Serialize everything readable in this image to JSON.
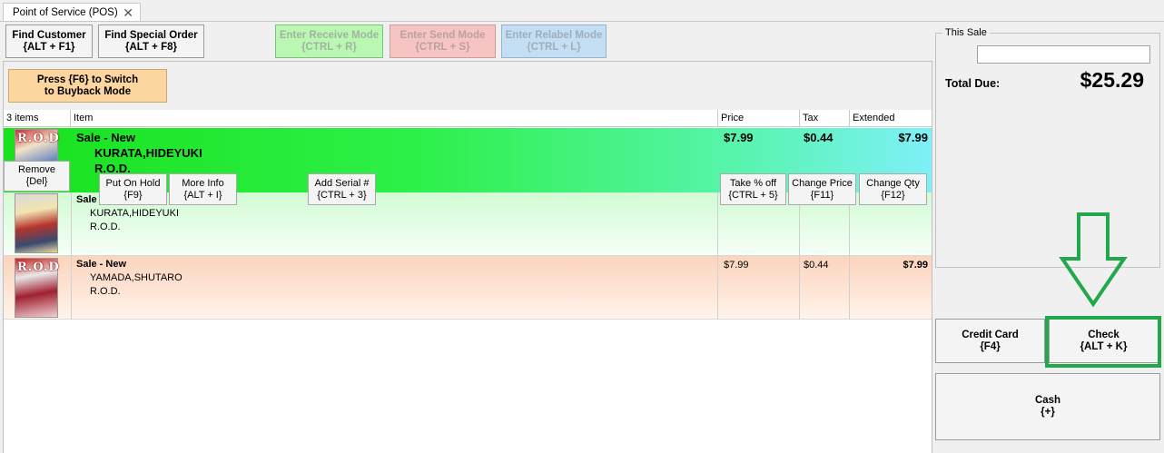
{
  "tab": {
    "title": "Point of Service (POS)",
    "close": "✕"
  },
  "toolbar": {
    "find_customer": {
      "label": "Find Customer",
      "shortcut": "{ALT + F1}"
    },
    "find_special_order": {
      "label": "Find Special Order",
      "shortcut": "{ALT + F8}"
    },
    "receive_mode": {
      "label": "Enter Receive Mode",
      "shortcut": "{CTRL + R}"
    },
    "send_mode": {
      "label": "Enter Send Mode",
      "shortcut": "{CTRL + S}"
    },
    "relabel_mode": {
      "label": "Enter Relabel Mode",
      "shortcut": "{CTRL + L}"
    }
  },
  "buyback": {
    "line1": "Press {F6} to Switch",
    "line2": "to Buyback Mode"
  },
  "grid": {
    "headers": {
      "count": "3 items",
      "item": "Item",
      "price": "Price",
      "tax": "Tax",
      "extended": "Extended"
    },
    "rows": [
      {
        "cover_title": "R.O.D",
        "type": "Sale - New",
        "author": "KURATA,HIDEYUKI",
        "title": "R.O.D.",
        "price": "$7.99",
        "tax": "$0.44",
        "extended": "$7.99"
      },
      {
        "cover_title": "",
        "type": "Sale",
        "author": "KURATA,HIDEYUKI",
        "title": "R.O.D.",
        "price": "",
        "tax": "",
        "extended": ""
      },
      {
        "cover_title": "R.O.D",
        "type": "Sale - New",
        "author": "YAMADA,SHUTARO",
        "title": "R.O.D.",
        "price": "$7.99",
        "tax": "$0.44",
        "extended": "$7.99"
      }
    ]
  },
  "row_actions": {
    "remove": {
      "label": "Remove",
      "shortcut": "{Del}"
    },
    "put_on_hold": {
      "label": "Put On Hold",
      "shortcut": "{F9}"
    },
    "more_info": {
      "label": "More Info",
      "shortcut": "{ALT + I}"
    },
    "add_serial": {
      "label": "Add Serial #",
      "shortcut": "{CTRL + 3}"
    },
    "take_percent_off": {
      "label": "Take % off",
      "shortcut": "{CTRL + 5}"
    },
    "change_price": {
      "label": "Change Price",
      "shortcut": "{F11}"
    },
    "change_qty": {
      "label": "Change Qty",
      "shortcut": "{F12}"
    }
  },
  "sale": {
    "legend": "This Sale",
    "input_value": "",
    "total_label": "Total Due:",
    "total_value": "$25.29"
  },
  "payment": {
    "credit_card": {
      "label": "Credit Card",
      "shortcut": "{F4}"
    },
    "check": {
      "label": "Check",
      "shortcut": "{ALT + K}"
    },
    "cash": {
      "label": "Cash",
      "shortcut": "{+}"
    }
  },
  "colors": {
    "highlight": "#21a84a",
    "selected_row": "#19e11c"
  }
}
